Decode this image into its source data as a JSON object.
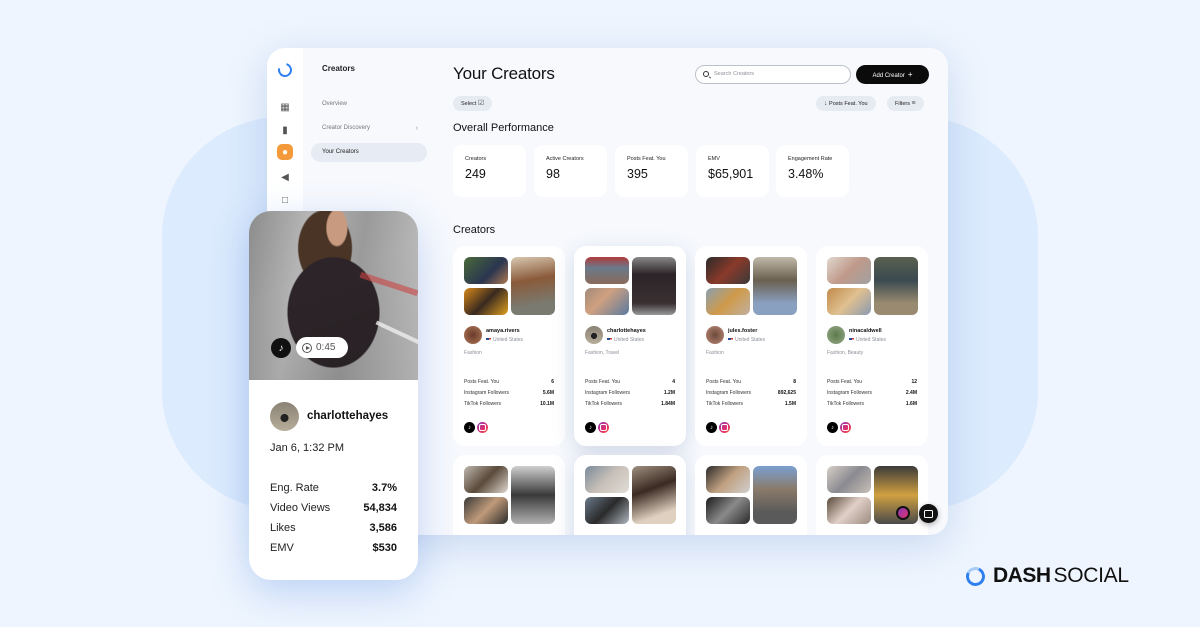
{
  "sidebar": {
    "title": "Creators",
    "icons": [
      "logo-icon",
      "dashboard-icon",
      "analytics-icon",
      "creators-icon",
      "campaigns-icon",
      "messages-icon"
    ],
    "items": [
      {
        "label": "Overview",
        "active": false
      },
      {
        "label": "Creator Discovery",
        "active": false,
        "chevron": "›"
      },
      {
        "label": "Your Creators",
        "active": true
      }
    ]
  },
  "header": {
    "title": "Your Creators",
    "search_placeholder": "Search Creators",
    "add_button": "Add Creator",
    "add_icon": "+",
    "select_chip": "Select",
    "sort_chip": "Posts Feat. You",
    "filters_chip": "Filters"
  },
  "performance": {
    "title": "Overall Performance",
    "stats": [
      {
        "label": "Creators",
        "value": "249"
      },
      {
        "label": "Active Creators",
        "value": "98"
      },
      {
        "label": "Posts Feat. You",
        "value": "395"
      },
      {
        "label": "EMV",
        "value": "$65,901"
      },
      {
        "label": "Engagement Rate",
        "value": "3.48%"
      }
    ]
  },
  "creators": {
    "title": "Creators",
    "stat_labels": [
      "Posts Feat. You",
      "Instagram Followers",
      "TikTok Followers"
    ],
    "cards": [
      {
        "handle": "amaya.rivers",
        "country": "United States",
        "tags": "Fashion",
        "posts": "6",
        "instagram": "5.6M",
        "tiktok": "10.1M"
      },
      {
        "handle": "charlottehayes",
        "country": "United States",
        "tags": "Fashion, Travel",
        "posts": "4",
        "instagram": "1.2M",
        "tiktok": "1.84M"
      },
      {
        "handle": "jules.foster",
        "country": "United States",
        "tags": "Fashion",
        "posts": "8",
        "instagram": "892,625",
        "tiktok": "1.5M"
      },
      {
        "handle": "ninacaldwell",
        "country": "United States",
        "tags": "Fashion, Beauty",
        "posts": "12",
        "instagram": "2.4M",
        "tiktok": "1.6M"
      }
    ]
  },
  "post_preview": {
    "platform": "TikTok",
    "duration": "0:45",
    "handle": "charlottehayes",
    "date": "Jan 6, 1:32 PM",
    "stats": [
      {
        "label": "Eng. Rate",
        "value": "3.7%"
      },
      {
        "label": "Video Views",
        "value": "54,834"
      },
      {
        "label": "Likes",
        "value": "3,586"
      },
      {
        "label": "EMV",
        "value": "$530"
      }
    ]
  },
  "brand": {
    "part1": "DASH",
    "part2": "SOCIAL"
  },
  "colors": {
    "accent": "#2f7ff0",
    "active_nav": "#f59a3b",
    "primary_button": "#0b0b0b",
    "background": "#eef5fe"
  }
}
